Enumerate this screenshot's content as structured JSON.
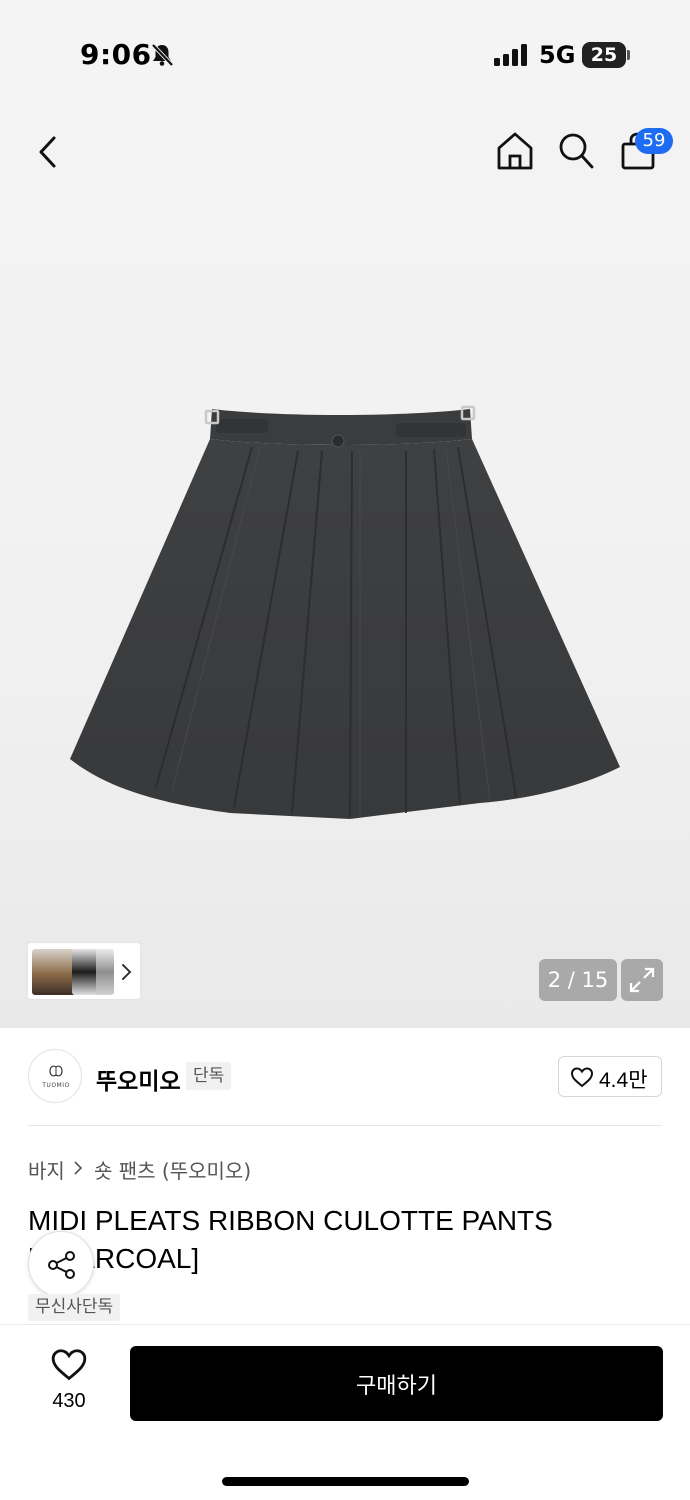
{
  "status_bar": {
    "time": "9:06",
    "network": "5G",
    "battery": "25"
  },
  "nav": {
    "icons": [
      "back-icon",
      "home-icon",
      "search-icon",
      "shopping-bag-icon"
    ],
    "cart_count": "59"
  },
  "gallery": {
    "counter": "2 / 15",
    "icons": [
      "chevron-right-icon",
      "expand-icon"
    ]
  },
  "brand": {
    "logo_text": "TUOMIO",
    "name": "뚜오미오",
    "exclusive_tag": "단독",
    "likes": "4.4만"
  },
  "breadcrumb": {
    "category": "바지",
    "subcategory": "숏 팬츠 (뚜오미오)"
  },
  "product": {
    "title": "MIDI PLEATS RIBBON CULOTTE PANTS [CHARCOAL]",
    "tag": "무신사단독"
  },
  "bottom_bar": {
    "wish_count": "430",
    "buy_label": "구매하기"
  },
  "colors": {
    "accent_badge": "#1e6cf2",
    "buy_button": "#000000",
    "product_fabric": "#3d3d3f"
  }
}
